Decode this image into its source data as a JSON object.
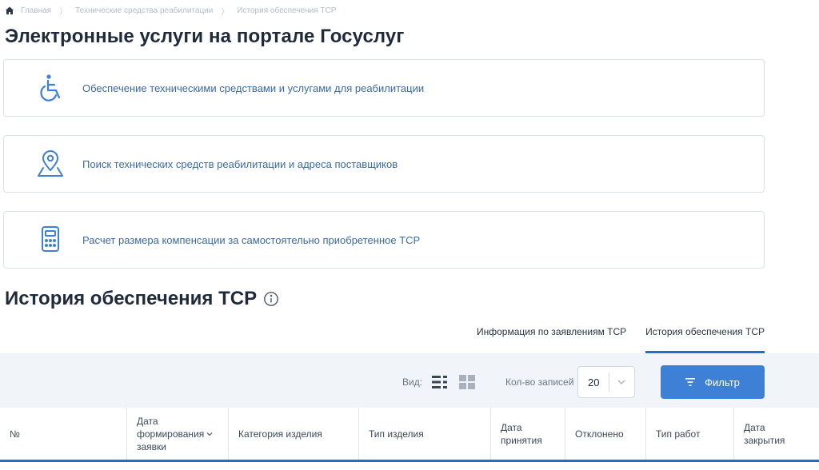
{
  "breadcrumb": {
    "items": [
      "Главная",
      "Технические средства реабилитации",
      "История обеспечения ТСР"
    ],
    "separator": "〉"
  },
  "page_title": "Электронные услуги на портале Госуслуг",
  "services": [
    {
      "label": "Обеспечение техническими средствами и услугами для реабилитации",
      "icon": "wheelchair-icon"
    },
    {
      "label": "Поиск технических средств реабилитации и адреса поставщиков",
      "icon": "map-pin-icon"
    },
    {
      "label": "Расчет размера компенсации за самостоятельно приобретенное ТСР",
      "icon": "calculator-icon"
    }
  ],
  "history_title": "История обеспечения ТСР",
  "tabs": [
    {
      "label": "Информация по заявлениям ТСР",
      "active": false
    },
    {
      "label": "История обеспечения ТСР",
      "active": true
    }
  ],
  "toolbar": {
    "view_label": "Вид:",
    "count_label": "Кол-во записей",
    "count_value": "20",
    "filter_label": "Фильтр"
  },
  "table": {
    "columns": [
      "№",
      "Дата формирования заявки",
      "Категория изделия",
      "Тип изделия",
      "Дата принятия",
      "Отклонено",
      "Тип работ",
      "Дата закрытия"
    ]
  },
  "colors": {
    "accent": "#1f6fc6",
    "button": "#3d80d6",
    "link": "#3b6aa0",
    "toolbar_bg": "#f1f4f8"
  }
}
